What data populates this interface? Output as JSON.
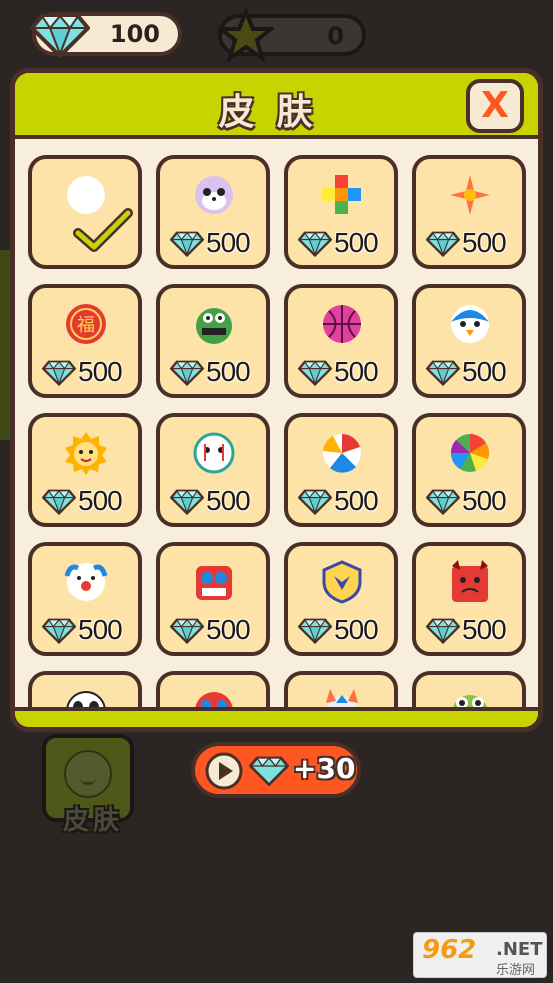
{
  "hud": {
    "gems": "100",
    "stars": "0"
  },
  "panel": {
    "title": "皮肤",
    "close_label": "X"
  },
  "skins": [
    {
      "id": "white",
      "price": "",
      "selected": true,
      "icon": "white-ball-icon"
    },
    {
      "id": "seal",
      "price": "500",
      "icon": "seal-face-icon"
    },
    {
      "id": "blocks",
      "price": "500",
      "icon": "color-blocks-icon"
    },
    {
      "id": "shuriken",
      "price": "500",
      "icon": "shuriken-icon"
    },
    {
      "id": "fu",
      "price": "500",
      "icon": "fu-charm-icon"
    },
    {
      "id": "monster",
      "price": "500",
      "icon": "green-monster-icon"
    },
    {
      "id": "basketball",
      "price": "500",
      "icon": "basketball-icon"
    },
    {
      "id": "penguin",
      "price": "500",
      "icon": "penguin-icon"
    },
    {
      "id": "lion",
      "price": "500",
      "icon": "lion-icon"
    },
    {
      "id": "mask",
      "price": "500",
      "icon": "noh-mask-icon"
    },
    {
      "id": "beachball",
      "price": "500",
      "icon": "beach-ball-icon"
    },
    {
      "id": "wheel",
      "price": "500",
      "icon": "color-wheel-icon"
    },
    {
      "id": "clown",
      "price": "500",
      "icon": "clown-icon"
    },
    {
      "id": "robot",
      "price": "500",
      "icon": "robot-icon"
    },
    {
      "id": "shield",
      "price": "500",
      "icon": "shield-icon"
    },
    {
      "id": "demon",
      "price": "500",
      "icon": "red-demon-icon"
    },
    {
      "id": "panda",
      "price": "",
      "icon": "panda-icon"
    },
    {
      "id": "dragon",
      "price": "",
      "icon": "dragon-icon"
    },
    {
      "id": "horned",
      "price": "",
      "icon": "horned-icon"
    },
    {
      "id": "frog",
      "price": "",
      "icon": "frog-icon"
    }
  ],
  "bottom": {
    "skin_button_label": "皮肤",
    "video_reward": "+30"
  },
  "watermark": {
    "number": "962",
    "domain": ".NET",
    "cn": "乐游网"
  },
  "colors": {
    "panel_border": "#4a2f28",
    "header": "#c8d400",
    "cell_bg": "#fde3a7",
    "accent": "#ff5722",
    "gem": "#7fe0e0"
  }
}
